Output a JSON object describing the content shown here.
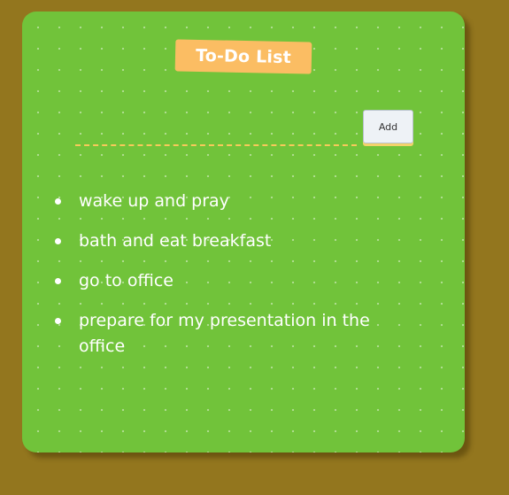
{
  "header": {
    "title": "To-Do List"
  },
  "input": {
    "value": "",
    "placeholder": "",
    "add_label": "Add"
  },
  "todos": [
    {
      "text": "wake up and pray"
    },
    {
      "text": "bath and eat breakfast"
    },
    {
      "text": "go to office"
    },
    {
      "text": "prepare for my presentation in the office"
    }
  ],
  "colors": {
    "background": "#93761e",
    "card": "#71c33a",
    "title_tag": "#fbbd63",
    "input_underline": "#f7c95a",
    "text": "#ffffff"
  }
}
